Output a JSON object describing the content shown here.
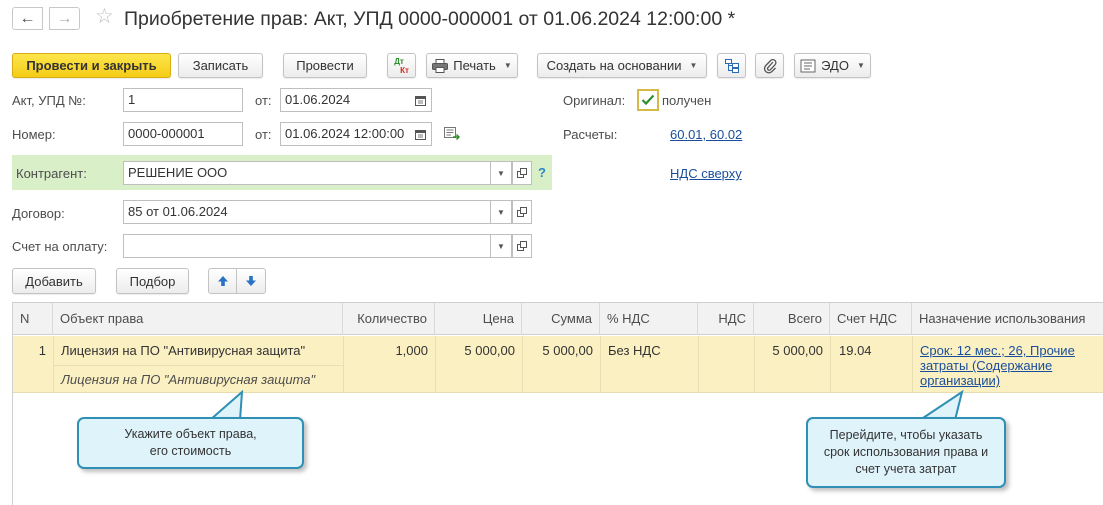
{
  "window": {
    "title": "Приобретение прав: Акт, УПД 0000-000001 от 01.06.2024 12:00:00 *"
  },
  "toolbar": {
    "post_close_label": "Провести и закрыть",
    "save_label": "Записать",
    "post_label": "Провести",
    "dtkt_label_top": "Дт",
    "dtkt_label_bottom": "Кт",
    "print_label": "Печать",
    "create_basis_label": "Создать на основании",
    "edo_label": "ЭДО"
  },
  "form": {
    "act_label": "Акт, УПД №:",
    "act_value": "1",
    "from_label": "от:",
    "act_date": "01.06.2024",
    "number_label": "Номер:",
    "number_value": "0000-000001",
    "from_label2": "от:",
    "number_date": "01.06.2024 12:00:00",
    "original_label": "Оригинал:",
    "original_checked": true,
    "original_value_label": "получен",
    "settlements_label": "Расчеты:",
    "settlements_link": "60.01, 60.02",
    "counterparty_label": "Контрагент:",
    "counterparty_value": "РЕШЕНИЕ ООО",
    "help_label": "?",
    "vat_link": "НДС сверху",
    "contract_label": "Договор:",
    "contract_value": "85 от 01.06.2024",
    "invoice_label": "Счет на оплату:",
    "invoice_value": ""
  },
  "table_toolbar": {
    "add_label": "Добавить",
    "pick_label": "Подбор"
  },
  "table": {
    "headers": [
      "N",
      "Объект права",
      "Количество",
      "Цена",
      "Сумма",
      "% НДС",
      "НДС",
      "Всего",
      "Счет НДС",
      "Назначение использования"
    ],
    "rows": [
      {
        "n": "1",
        "object": "Лицензия на ПО \"Антивирусная защита\"",
        "object_sub": "Лицензия на ПО \"Антивирусная защита\"",
        "qty": "1,000",
        "price": "5 000,00",
        "sum": "5 000,00",
        "vat_rate": "Без НДС",
        "vat": "",
        "total": "5 000,00",
        "vat_account": "19.04",
        "purpose_line1": "Срок: 12 мес.; 26, Прочие",
        "purpose_line2": "затраты (Содержание",
        "purpose_line3": "организации)"
      }
    ]
  },
  "callouts": {
    "left_line1": "Укажите объект права,",
    "left_line2": "его стоимость",
    "right_line1": "Перейдите, чтобы указать",
    "right_line2": "срок использования права и",
    "right_line3": "счет учета затрат"
  },
  "colors": {
    "primary_button": "#f5cc17",
    "counterparty_band": "#d8efc8",
    "selected_row": "#fbf0c2",
    "link": "#1a4e9c",
    "callout_border": "#2f8fb5",
    "callout_fill": "#dff3fb"
  }
}
